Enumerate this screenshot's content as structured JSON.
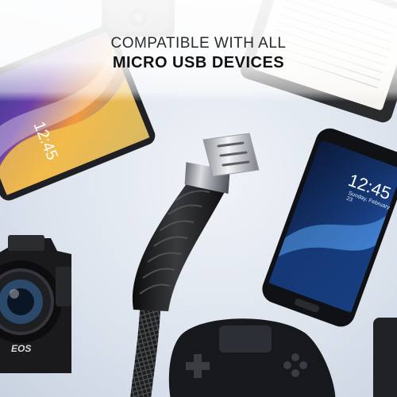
{
  "banner": {
    "line1": "COMPATIBLE WITH ALL",
    "line2": "MICRO USB DEVICES"
  },
  "tablet": {
    "clock": "12:45"
  },
  "phone": {
    "clock": "12:45",
    "date": "Sunday, February 23"
  },
  "camera": {
    "brand": "EOS"
  }
}
